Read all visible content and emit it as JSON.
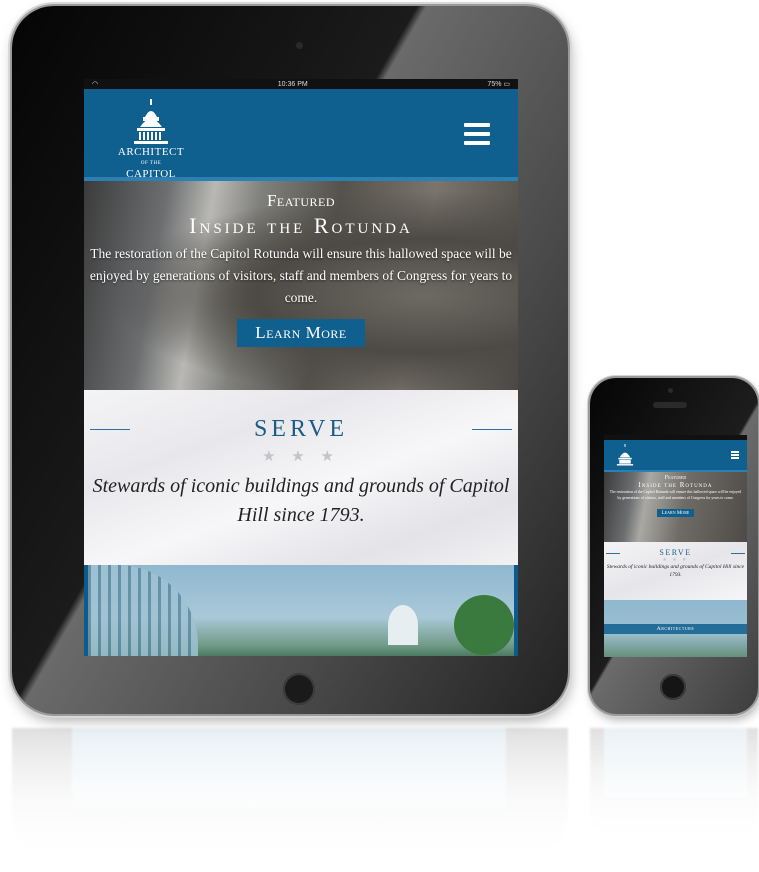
{
  "status_bar": {
    "time": "10:36 PM",
    "battery": "75%",
    "wifi_icon": "wifi-icon"
  },
  "site": {
    "logo": {
      "line1": "ARCHITECT",
      "line2_prefix": "OF THE",
      "line2": "CAPITOL",
      "icon": "capitol-dome-icon"
    },
    "menu_icon": "hamburger-menu-icon"
  },
  "hero": {
    "kicker": "Featured",
    "title": "Inside the Rotunda",
    "description": "The restoration of the Capitol Rotunda will ensure this hallowed space will be enjoyed by generations of visitors, staff and members of Congress for years to come.",
    "button_label": "Learn More"
  },
  "serve": {
    "title": "SERVE",
    "stars": "★ ★ ★",
    "tagline": "Stewards of iconic buildings and grounds of Capitol Hill since 1793."
  },
  "phone": {
    "section_bar_label": "Architecture"
  },
  "colors": {
    "brand_blue": "#0f5f8f",
    "accent_blue": "#2c7fb3",
    "serve_title": "#1b5c86"
  }
}
